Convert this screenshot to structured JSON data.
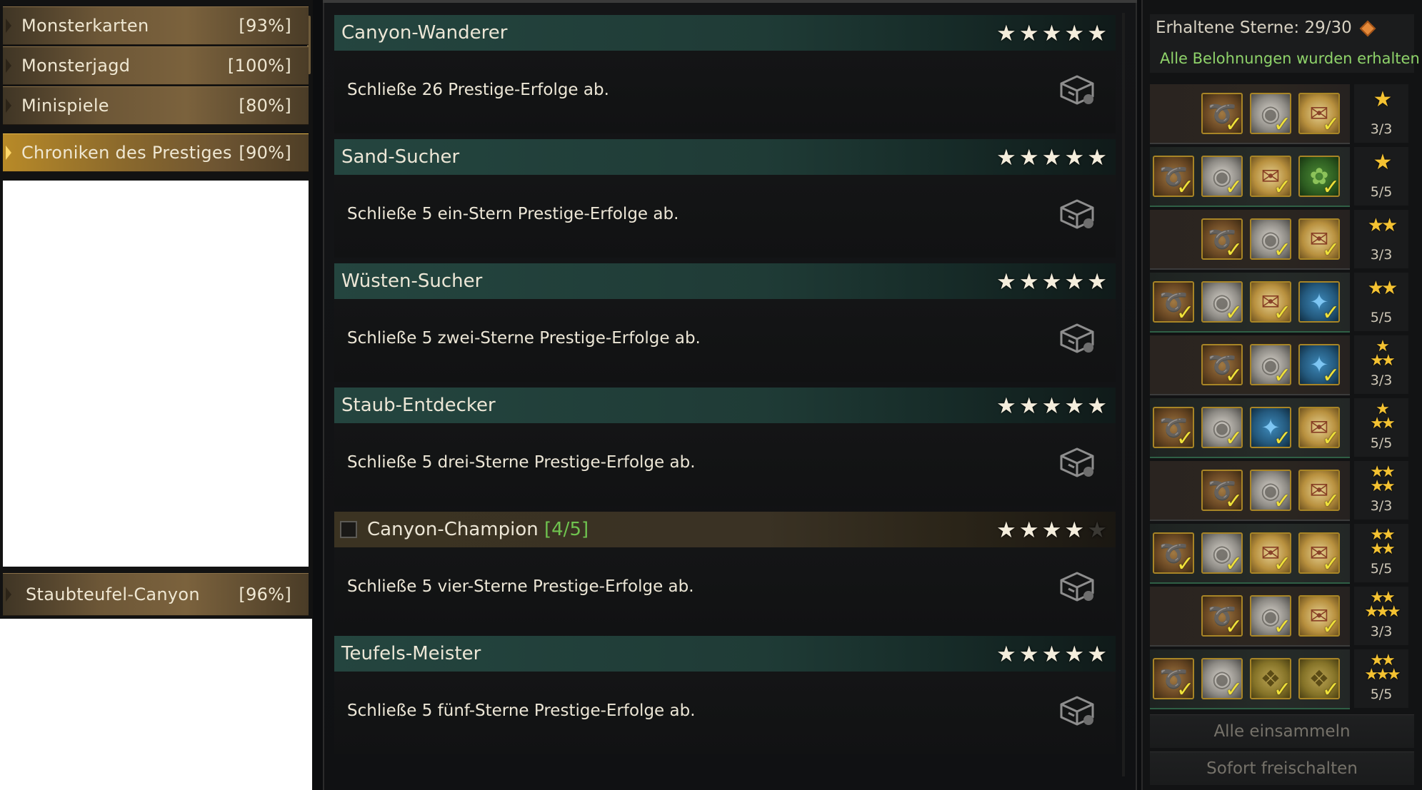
{
  "sidebar": {
    "categories": [
      {
        "label": "Monsterkarten",
        "pct": "[93%]"
      },
      {
        "label": "Monsterjagd",
        "pct": "[100%]"
      },
      {
        "label": "Minispiele",
        "pct": "[80%]"
      },
      {
        "label": "Chroniken des Prestiges",
        "pct": "[90%]"
      }
    ],
    "sub_category": {
      "label": "Staubteufel-Canyon",
      "pct": "[96%]"
    }
  },
  "achievements": [
    {
      "title": "Canyon-Wanderer",
      "progress": "",
      "stars_filled": 5,
      "desc": "Schließe 26 Prestige-Erfolge ab."
    },
    {
      "title": "Sand-Sucher",
      "progress": "",
      "stars_filled": 5,
      "desc": "Schließe 5 ein-Stern Prestige-Erfolge ab."
    },
    {
      "title": "Wüsten-Sucher",
      "progress": "",
      "stars_filled": 5,
      "desc": "Schließe 5 zwei-Sterne Prestige-Erfolge ab."
    },
    {
      "title": "Staub-Entdecker",
      "progress": "",
      "stars_filled": 5,
      "desc": "Schließe 5 drei-Sterne Prestige-Erfolge ab."
    },
    {
      "title": "Canyon-Champion",
      "progress": "[4/5]",
      "stars_filled": 4,
      "desc": "Schließe 5 vier-Sterne Prestige-Erfolge ab."
    },
    {
      "title": "Teufels-Meister",
      "progress": "",
      "stars_filled": 5,
      "desc": "Schließe 5 fünf-Sterne Prestige-Erfolge ab."
    }
  ],
  "rewards_panel": {
    "stars_label": "Erhaltene Sterne: 29/30",
    "status": "Alle Belohnungen wurden erhalten",
    "tiers": [
      {
        "stars": 1,
        "count": "3/3",
        "icons": [
          "coin",
          "silver",
          "scroll"
        ]
      },
      {
        "stars": 1,
        "count": "5/5",
        "icons": [
          "coin",
          "silver",
          "scroll",
          "green"
        ]
      },
      {
        "stars": 2,
        "count": "3/3",
        "icons": [
          "coin",
          "silver",
          "scroll"
        ]
      },
      {
        "stars": 2,
        "count": "5/5",
        "icons": [
          "coin",
          "silver",
          "scroll",
          "blue"
        ]
      },
      {
        "stars": 3,
        "count": "3/3",
        "icons": [
          "coin",
          "silver",
          "blue"
        ]
      },
      {
        "stars": 3,
        "count": "5/5",
        "icons": [
          "coin",
          "silver",
          "blue",
          "scroll"
        ]
      },
      {
        "stars": 4,
        "count": "3/3",
        "icons": [
          "coin",
          "silver",
          "scroll"
        ]
      },
      {
        "stars": 4,
        "count": "5/5",
        "icons": [
          "coin",
          "silver",
          "scroll",
          "scroll"
        ]
      },
      {
        "stars": 5,
        "count": "3/3",
        "icons": [
          "coin",
          "silver",
          "scroll"
        ]
      },
      {
        "stars": 5,
        "count": "5/5",
        "icons": [
          "coin",
          "silver",
          "map",
          "map"
        ]
      }
    ],
    "collect_all": "Alle einsammeln",
    "unlock_now": "Sofort freischalten"
  },
  "icons": {
    "checkmark": "checkmark-icon",
    "star": "star-icon",
    "chest": "treasure-chest-icon",
    "gem": "gem-icon"
  }
}
